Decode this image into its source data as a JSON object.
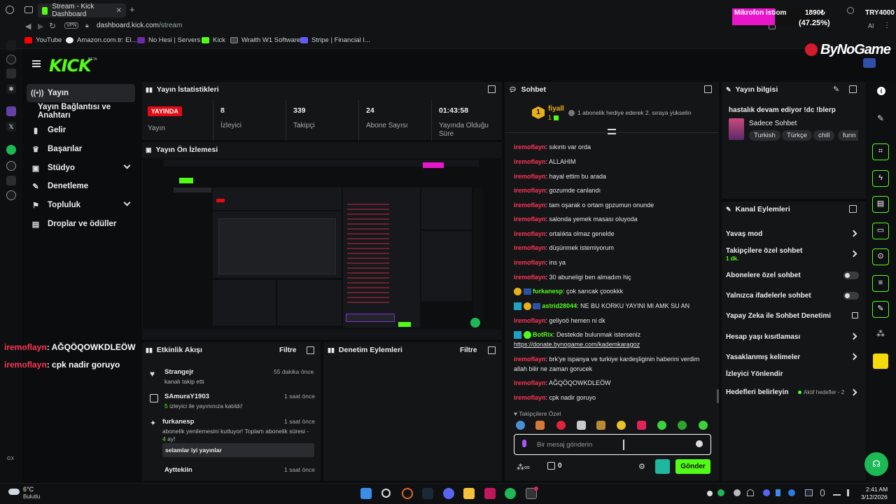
{
  "browser": {
    "tab_title": "Stream - Kick Dashboard",
    "vpn": "VPN",
    "url_host": "dashboard.kick.com",
    "url_path": "/stream",
    "bookmarks": [
      "YouTube",
      "Amazon.com.tr: El...",
      "No Hesi | Servers",
      "Kick",
      "Wraith W1 Software",
      "Stripe | Financial I..."
    ],
    "rail_label": "GX"
  },
  "overlay": {
    "mic_label": "Mikrofon istiom",
    "mic_amount": "1890₺",
    "mic_percent": "(47.25%)",
    "goal": "TRY4000",
    "brand": "ByNoGame"
  },
  "kick": {
    "logo": "KICK",
    "beta": "BETA"
  },
  "nav": [
    {
      "label": "Yayın",
      "icon": "broadcast-icon"
    },
    {
      "label": "Yayın Bağlantısı ve Anahtarı",
      "icon": "key-icon"
    },
    {
      "label": "Gelir",
      "icon": "chart-icon"
    },
    {
      "label": "Başarılar",
      "icon": "trophy-icon"
    },
    {
      "label": "Stüdyo",
      "icon": "palette-icon"
    },
    {
      "label": "Denetleme",
      "icon": "wrench-icon"
    },
    {
      "label": "Topluluk",
      "icon": "flag-icon"
    },
    {
      "label": "Droplar ve ödüller",
      "icon": "gift-icon"
    }
  ],
  "stats": {
    "title": "Yayın İstatistikleri",
    "live_badge": "YAYINDA",
    "live_label": "Yayın",
    "viewers": "8",
    "viewers_label": "İzleyici",
    "followers": "339",
    "followers_label": "Takipçi",
    "subs": "24",
    "subs_label": "Abone Sayısı",
    "uptime": "01:43:58",
    "uptime_label": "Yayında Olduğu Süre"
  },
  "preview": {
    "title": "Yayın Ön İzlemesi"
  },
  "overlay_chat": [
    {
      "user": "iremoflayn",
      "text": ": AĞQÖQOWKDLEÖW"
    },
    {
      "user": "iremoflayn",
      "text": ": cpk nadir goruyo"
    }
  ],
  "activity": {
    "title": "Etkinlik Akışı",
    "filter": "Filtre",
    "items": [
      {
        "name": "Strangejr",
        "time": "55 dakika önce",
        "sub": "kanalı takip etti"
      },
      {
        "name": "SAmuraY1903",
        "time": "1 saat önce",
        "sub_num": "5",
        "sub": " izleyici ile yayınınıza katıldı!"
      },
      {
        "name": "furkanesp",
        "time": "1 saat önce",
        "sub": "abonelik yenilemesini kutluyor! Toplam abonelik süresi -",
        "sub_num": "4",
        "sub2": " ay!",
        "msg": "selamlar iyi yayınlar"
      },
      {
        "name": "Ayttekiin",
        "time": "1 saat önce"
      }
    ]
  },
  "moderation": {
    "title": "Denetim Eylemleri",
    "filter": "Filtre"
  },
  "chat": {
    "title": "Sohbet",
    "pinned_user": "fiyall",
    "pinned_count": "1",
    "pinned_text": "1 abonelik hediye ederek 2. sıraya yükselin",
    "messages": [
      {
        "user": "iremoflayn",
        "text": ": sıkıntı var orda"
      },
      {
        "user": "iremoflayn",
        "text": ": ALLAHIM"
      },
      {
        "user": "iremoflayn",
        "text": ": hayal ettim bu arada"
      },
      {
        "user": "iremoflayn",
        "text": ": gozumde canlandı"
      },
      {
        "user": "iremoflayn",
        "text": ": tam oşarak o ortam gpzumun onunde"
      },
      {
        "user": "iremoflayn",
        "text": ": salonda yemek masası oluyoda"
      },
      {
        "user": "iremoflayn",
        "text": ": ortalıkta olmaz genelde"
      },
      {
        "user": "iremoflayn",
        "text": ": düşünmek istemiyorum"
      },
      {
        "user": "iremoflayn",
        "text": ": ins ya"
      },
      {
        "user": "iremoflayn",
        "text": ": 30 abuneligi ben almadım hiç"
      },
      {
        "user": "furkanesp",
        "text": ": çok sarıcak çoookkk",
        "style": "g"
      },
      {
        "user": "astrid28044",
        "text": ": NE BU KORKU YAYINI MI AMK SU AN",
        "style": "g"
      },
      {
        "user": "iremoflayn",
        "text": ": geliyoö hemen ni dk"
      },
      {
        "user": "BotRix",
        "text": ": Destekde bulunmak isterseniz",
        "style": "g",
        "link": "https://donate.bynogame.com/kademkaragoz"
      },
      {
        "user": "iremoflayn",
        "text": ": brk'ye ispanya ve turkiye kardeşliginin haberini verdim",
        "cont": "allah bilir ne zaman gorucek"
      },
      {
        "user": "iremoflayn",
        "text": ": AĞQÖQOWKDLEÖW"
      },
      {
        "user": "iremoflayn",
        "text": ": cpk nadir goruyo"
      }
    ],
    "followers_only": "Takipçilere Özel",
    "input_placeholder": "Bir mesaj gönderin",
    "count": "0",
    "send": "Gönder"
  },
  "info": {
    "title": "Yayın bilgisi",
    "stream_title": "hastalık devam ediyor !dc !blerp",
    "category": "Sadece Sohbet",
    "tags": [
      "Turkish",
      "Türkçe",
      "chill",
      "funn"
    ]
  },
  "channel_actions": {
    "title": "Kanal Eylemleri",
    "items": [
      {
        "label": "Yavaş mod",
        "type": "chevron"
      },
      {
        "label": "Takipçilere özel sohbet",
        "sub": "1 dk.",
        "type": "chevron"
      },
      {
        "label": "Abonelere özel sohbet",
        "type": "toggle"
      },
      {
        "label": "Yalnızca ifadelerle sohbet",
        "type": "toggle"
      },
      {
        "label": "Yapay Zeka ile Sohbet Denetimi",
        "type": "external"
      },
      {
        "label": "Hesap yaşı kısıtlaması",
        "type": "chevron"
      },
      {
        "label": "Yasaklanmış kelimeler",
        "type": "chevron"
      },
      {
        "label": "İzleyici Yönlendir",
        "type": "none"
      },
      {
        "label": "Hedefleri belirleyin",
        "sub": "Aktif hedefler - 2",
        "type": "chevron"
      }
    ]
  },
  "taskbar": {
    "temp": "6°C",
    "weather": "Bulutlu",
    "time": "2:41 AM",
    "date": "3/12/2026"
  },
  "colors": {
    "accent": "#53fc18",
    "username": "#ff3557",
    "live": "#e50914",
    "overlay_bar": "#e815c9"
  }
}
